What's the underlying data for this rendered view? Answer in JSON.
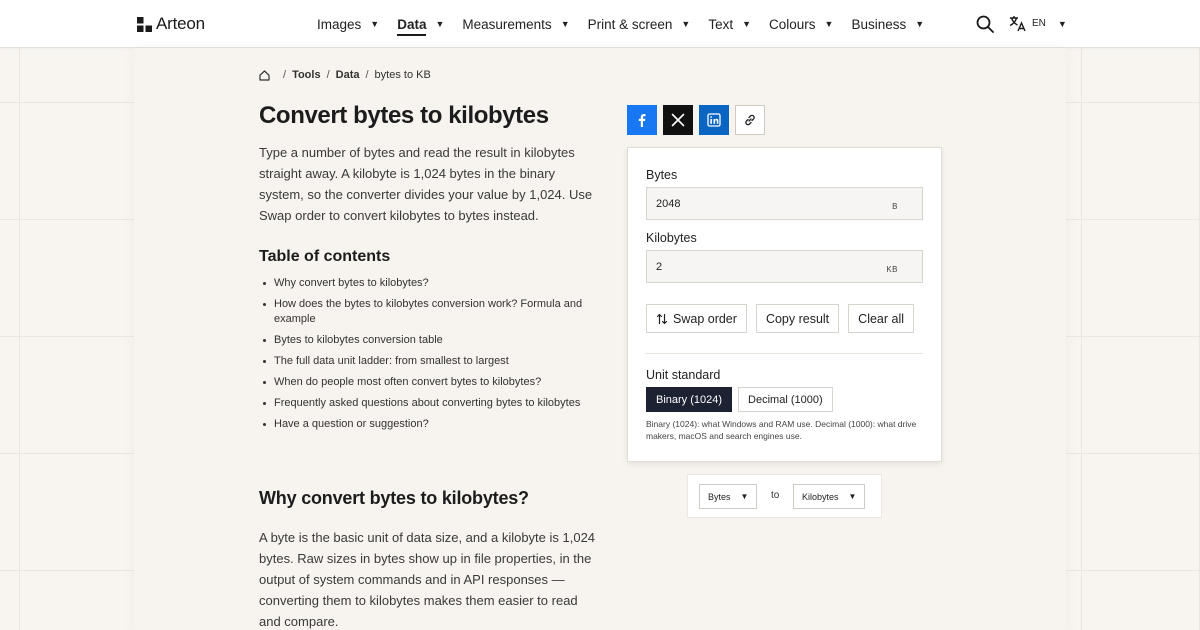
{
  "header": {
    "logo_text": "Arteon",
    "nav": [
      {
        "label": "Images",
        "active": false
      },
      {
        "label": "Data",
        "active": true
      },
      {
        "label": "Measurements",
        "active": false
      },
      {
        "label": "Print & screen",
        "active": false
      },
      {
        "label": "Text",
        "active": false
      },
      {
        "label": "Colours",
        "active": false
      },
      {
        "label": "Business",
        "active": false
      }
    ],
    "caret": "▼",
    "lang_code": "EN"
  },
  "breadcrumb": {
    "separator": "/",
    "items": [
      "Tools",
      "Data",
      "bytes to KB"
    ]
  },
  "article": {
    "title": "Convert bytes to kilobytes",
    "intro": "Type a number of bytes and read the result in kilobytes straight away. A kilobyte is 1,024 bytes in the binary system, so the converter divides your value by 1,024. Use Swap order to convert kilobytes to bytes instead.",
    "toc_title": "Table of contents",
    "toc": [
      "Why convert bytes to kilobytes?",
      "How does the bytes to kilobytes conversion work? Formula and example",
      "Bytes to kilobytes conversion table",
      "The full data unit ladder: from smallest to largest",
      "When do people most often convert bytes to kilobytes?",
      "Frequently asked questions about converting bytes to kilobytes",
      "Have a question or suggestion?"
    ],
    "section_heading": "Why convert bytes to kilobytes?",
    "section_text": "A byte is the basic unit of data size, and a kilobyte is 1,024 bytes. Raw sizes in bytes show up in file properties, in the output of system commands and in API responses — converting them to kilobytes makes them easier to read and compare."
  },
  "share": {
    "icons": [
      "facebook-icon",
      "x-icon",
      "linkedin-icon",
      "link-icon"
    ],
    "colors": {
      "facebook": "#1877f2",
      "x": "#111111",
      "linkedin": "#0a66c2"
    }
  },
  "converter": {
    "from_label": "Bytes",
    "from_value": "2048",
    "from_unit": "B",
    "to_label": "Kilobytes",
    "to_value": "2",
    "to_unit": "KB",
    "swap_label": "Swap order",
    "copy_label": "Copy result",
    "clear_label": "Clear all",
    "standard_label": "Unit standard",
    "standards": [
      {
        "label": "Binary (1024)",
        "active": true
      },
      {
        "label": "Decimal (1000)",
        "active": false
      }
    ],
    "standard_note": "Binary (1024): what Windows and RAM use. Decimal (1000): what drive makers, macOS and search engines use."
  },
  "selector": {
    "from": "Bytes",
    "to_word": "to",
    "to": "Kilobytes"
  }
}
